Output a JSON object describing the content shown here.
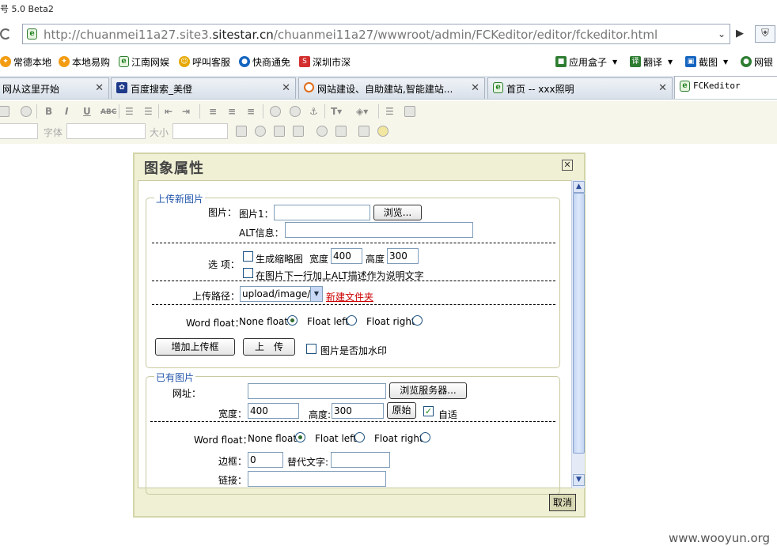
{
  "window": {
    "title": "号 5.0 Beta2"
  },
  "address": {
    "prefix": "http://chuanmei11a27.site3.",
    "domain": "sitestar.cn",
    "path": "/chuanmei11a27/wwwroot/admin/FCKeditor/editor/fckeditor.html"
  },
  "favorites": {
    "left": [
      {
        "label": "常德本地",
        "icon": "leaf-icon",
        "color": "#f39c12"
      },
      {
        "label": "本地易购",
        "icon": "leaf-icon",
        "color": "#f39c12"
      },
      {
        "label": "江南网娱",
        "icon": "ie-icon",
        "color": "#2e7d32"
      },
      {
        "label": "呼叫客服",
        "icon": "smiley-icon",
        "color": "#e6a700"
      },
      {
        "label": "快商通免",
        "icon": "globe-icon",
        "color": "#1565c0"
      },
      {
        "label": "深圳市深",
        "icon": "s-logo-icon",
        "color": "#d32f2f"
      }
    ],
    "right": [
      {
        "label": "应用盒子",
        "icon": "cube-icon",
        "color": "#2e7d32"
      },
      {
        "label": "翻译",
        "icon": "translate-icon",
        "color": "#2e7d32"
      },
      {
        "label": "截图",
        "icon": "screenshot-icon",
        "color": "#1565c0"
      },
      {
        "label": "网银",
        "icon": "globe-icon",
        "color": "#2e7d32"
      }
    ]
  },
  "tabs": [
    {
      "label": "网从这里开始",
      "icon": "none"
    },
    {
      "label": "百度搜索_美僜",
      "icon": "paw-icon"
    },
    {
      "label": "网站建设、自助建站,智能建站...",
      "icon": "loading-icon"
    },
    {
      "label": "首页 -- xxx照明",
      "icon": "ie-icon"
    },
    {
      "label": "FCKeditor",
      "icon": "ie-icon"
    }
  ],
  "toolbar": {
    "font_label": "字体",
    "size_label": "大小"
  },
  "dialog": {
    "title": "图象属性",
    "upload": {
      "legend": "上传新图片",
      "image_label": "图片：",
      "image1_label": "图片1：",
      "browse_btn": "浏览...",
      "alt_label": "ALT信息：",
      "options_label": "选 项：",
      "thumb_label": "生成缩略图",
      "width_label": "宽度",
      "width_value": "400",
      "height_label": "高度",
      "height_value": "300",
      "alt_caption_label": "在图片下一行加上ALT描述作为说明文字",
      "path_label": "上传路径：",
      "path_value": "upload/image/",
      "new_folder": "新建文件夹",
      "float_label": "Word float：",
      "float_none": "None float",
      "float_left": "Float left",
      "float_right": "Float right",
      "add_upload_btn": "增加上传框",
      "upload_btn": "上　传",
      "watermark_label": "图片是否加水印"
    },
    "existing": {
      "legend": "已有图片",
      "url_label": "网址：",
      "browse_server_btn": "浏览服务器...",
      "width_label": "宽度：",
      "width_value": "400",
      "height_label": "高度:",
      "height_value": "300",
      "original_btn": "原始",
      "auto_label": "自适",
      "float_label": "Word float：",
      "float_none": "None float",
      "float_left": "Float left",
      "float_right": "Float right",
      "border_label": "边框：",
      "border_value": "0",
      "alt_text_label": "替代文字:",
      "link_label": "链接："
    },
    "cancel_btn": "取消"
  },
  "watermark": "www.wooyun.org"
}
